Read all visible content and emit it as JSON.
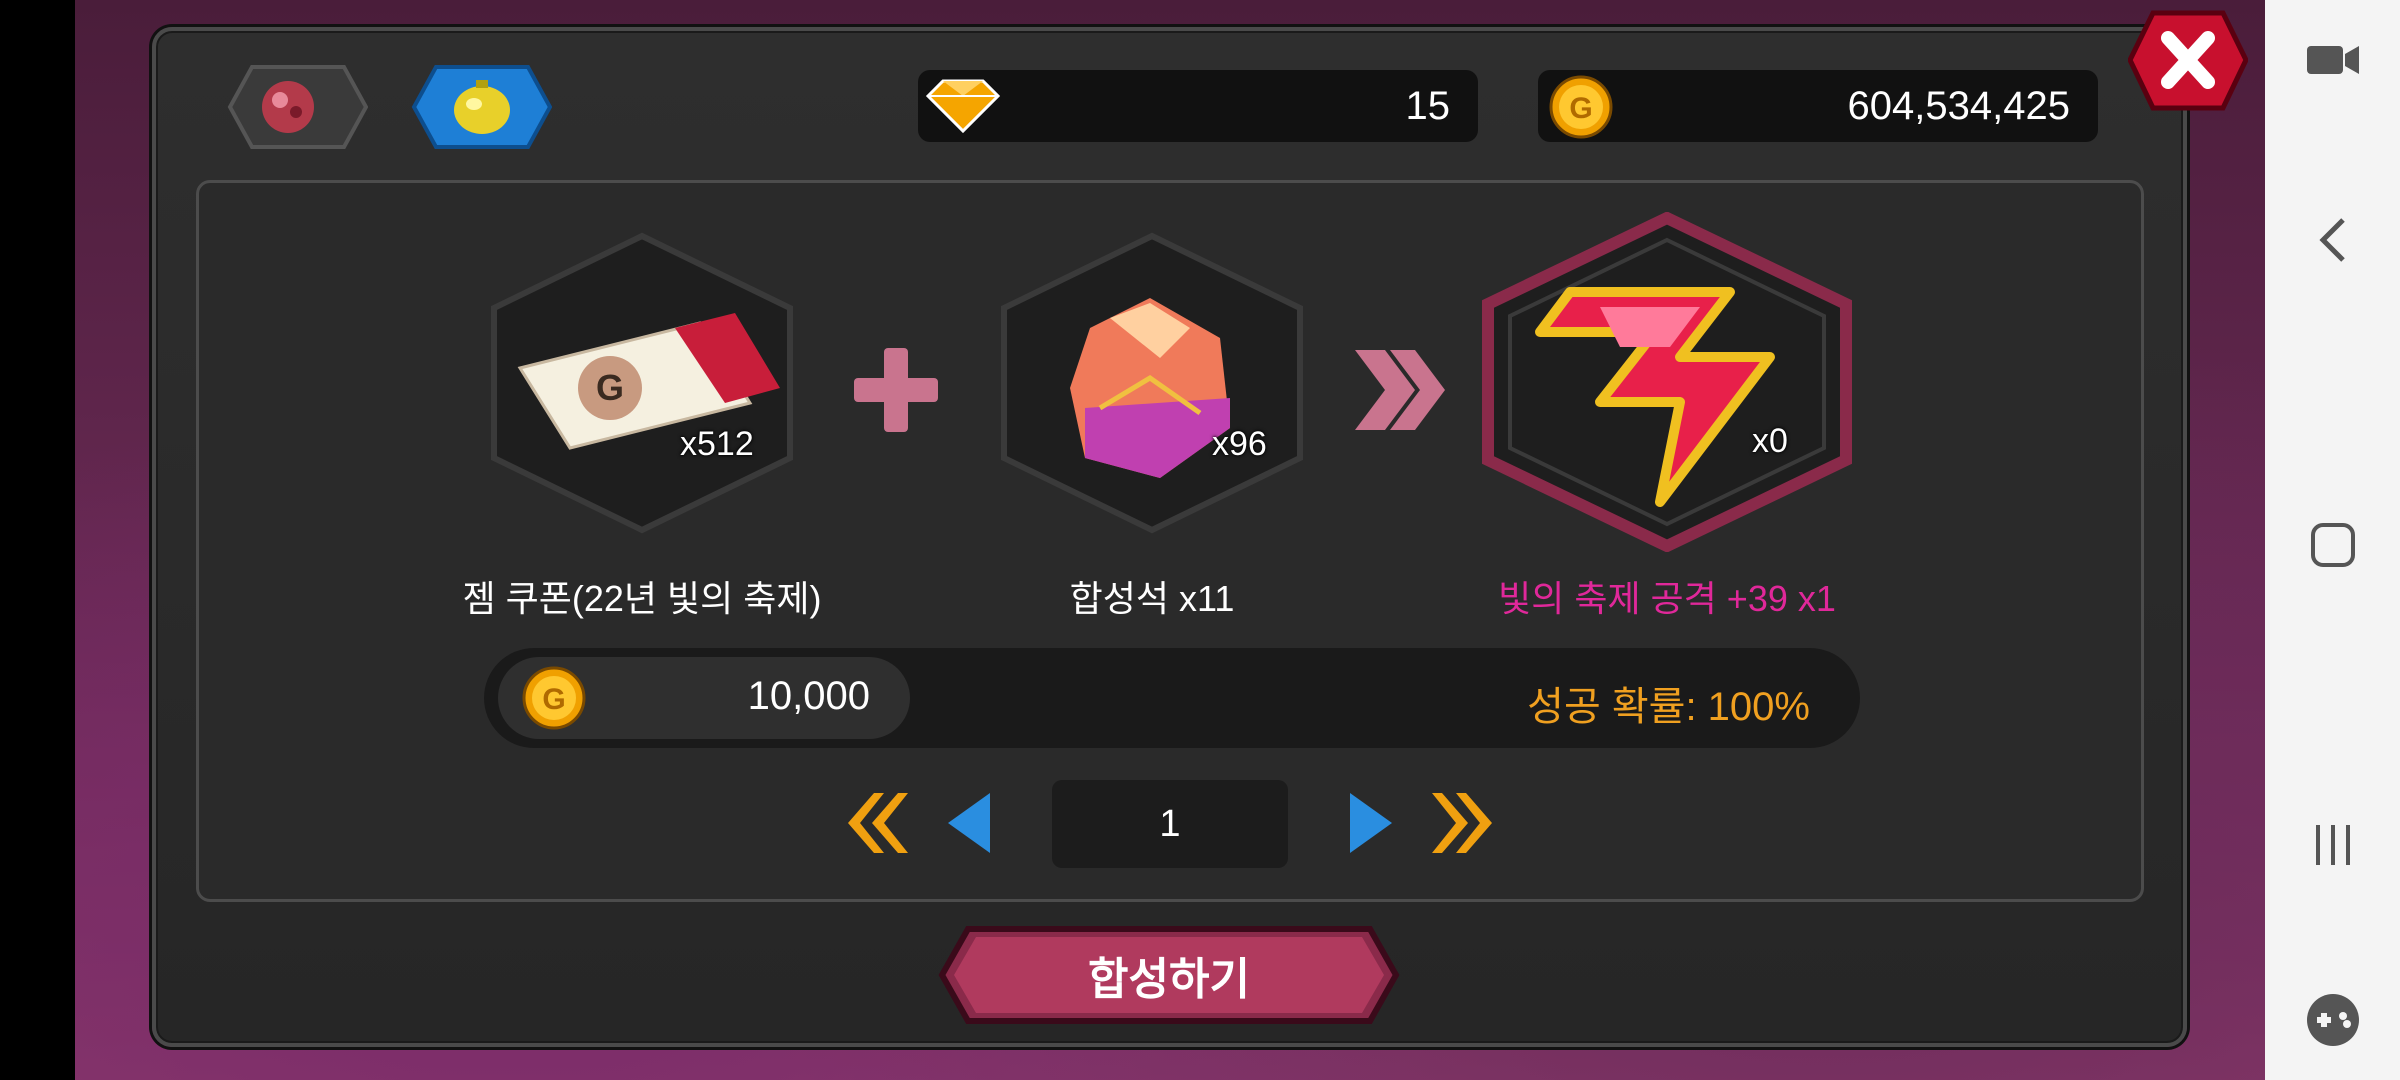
{
  "currencies": {
    "diamond_count": "15",
    "gold_count": "604,534,425"
  },
  "recipe": {
    "ingredient_1": {
      "name": "젬 쿠폰(22년 빛의 축제)",
      "owned": "x512"
    },
    "ingredient_2": {
      "name": "합성석 x11",
      "owned": "x96"
    },
    "result": {
      "name": "빛의 축제 공격 +39 x1",
      "owned": "x0",
      "name_color": "#e0289a"
    }
  },
  "cost": {
    "gold_cost": "10,000",
    "success_rate": "성공 확률: 100%"
  },
  "pagination": {
    "page": "1"
  },
  "craft_button": {
    "label": "합성하기"
  },
  "colors": {
    "accent_pink": "#c0406a",
    "gold_text": "#f0a020",
    "tab_blue": "#1e7fd6"
  },
  "icons": {
    "tab_1": "red-gem-icon",
    "tab_2": "gold-bell-icon",
    "diamond": "diamond-icon",
    "gold": "gold-coin-icon",
    "close": "close-icon"
  }
}
